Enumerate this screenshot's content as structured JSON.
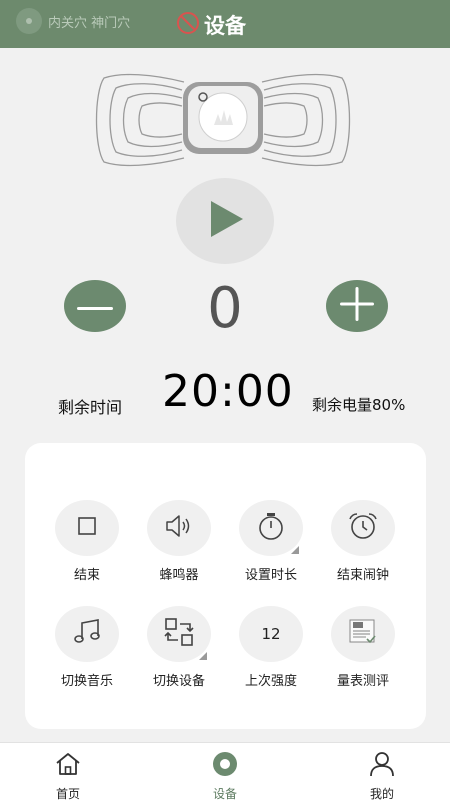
{
  "header": {
    "acupoint_text": "内关穴 神门穴",
    "title": "设备",
    "background_color": "#6d8a6d"
  },
  "device": {
    "image": "electrode-pad-device",
    "play_icon": "play-icon"
  },
  "intensity": {
    "value": "0",
    "minus_icon": "minus-icon",
    "plus_icon": "plus-icon"
  },
  "status": {
    "time_label": "剩余时间",
    "time_value": "20:00",
    "battery_text": "剩余电量80%"
  },
  "functions": [
    {
      "label": "结束",
      "icon": "stop-icon"
    },
    {
      "label": "蜂鸣器",
      "icon": "speaker-icon"
    },
    {
      "label": "设置时长",
      "icon": "timer-icon"
    },
    {
      "label": "结束闹钟",
      "icon": "alarm-clock-icon"
    },
    {
      "label": "切换音乐",
      "icon": "music-note-icon"
    },
    {
      "label": "切换设备",
      "icon": "switch-device-icon"
    },
    {
      "label": "上次强度",
      "icon": "last-intensity-value",
      "value": "12"
    },
    {
      "label": "量表测评",
      "icon": "questionnaire-icon"
    }
  ],
  "nav": [
    {
      "label": "首页",
      "icon": "home-icon"
    },
    {
      "label": "设备",
      "icon": "device-icon",
      "active": true
    },
    {
      "label": "我的",
      "icon": "user-icon"
    }
  ],
  "colors": {
    "accent": "#6c8a6f",
    "page_background": "#f1f1f1"
  }
}
